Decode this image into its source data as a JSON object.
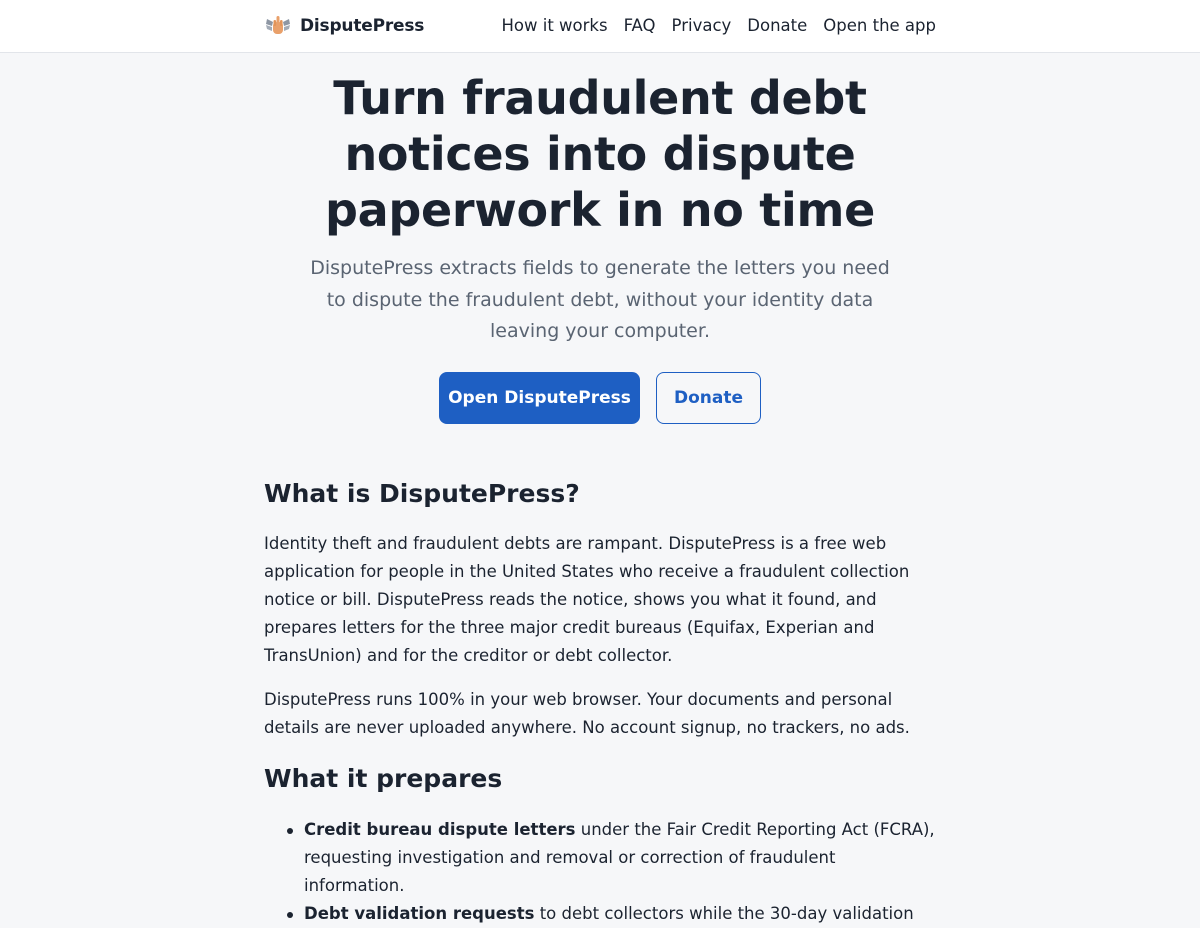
{
  "brand": {
    "name": "DisputePress",
    "logo_icon": "winged-hand-icon"
  },
  "nav": {
    "links": [
      "How it works",
      "FAQ",
      "Privacy",
      "Donate",
      "Open the app"
    ]
  },
  "hero": {
    "title": "Turn fraudulent debt notices into dispute paperwork in no time",
    "subtitle": "DisputePress extracts fields to generate the letters you need to dispute the fraudulent debt, without your identity data leaving your computer.",
    "primary_button": "Open DisputePress",
    "secondary_button": "Donate"
  },
  "about": {
    "heading": "What is DisputePress?",
    "paragraph1": "Identity theft and fraudulent debts are rampant. DisputePress is a free web application for people in the United States who receive a fraudulent collection notice or bill. DisputePress reads the notice, shows you what it found, and prepares letters for the three major credit bureaus (Equifax, Experian and TransUnion) and for the creditor or debt collector.",
    "paragraph2": "DisputePress runs 100% in your web browser. Your documents and personal details are never uploaded anywhere. No account signup, no trackers, no ads."
  },
  "prepares": {
    "heading": "What it prepares",
    "items": [
      {
        "bold": "Credit bureau dispute letters",
        "rest": " under the Fair Credit Reporting Act (FCRA), requesting investigation and removal or correction of fraudulent information."
      },
      {
        "bold": "Debt validation requests",
        "rest": " to debt collectors while the 30-day validation"
      }
    ]
  },
  "colors": {
    "accent": "#1e5fc3",
    "text": "#1b2330",
    "muted": "#5a6472",
    "background": "#f6f7f9"
  }
}
